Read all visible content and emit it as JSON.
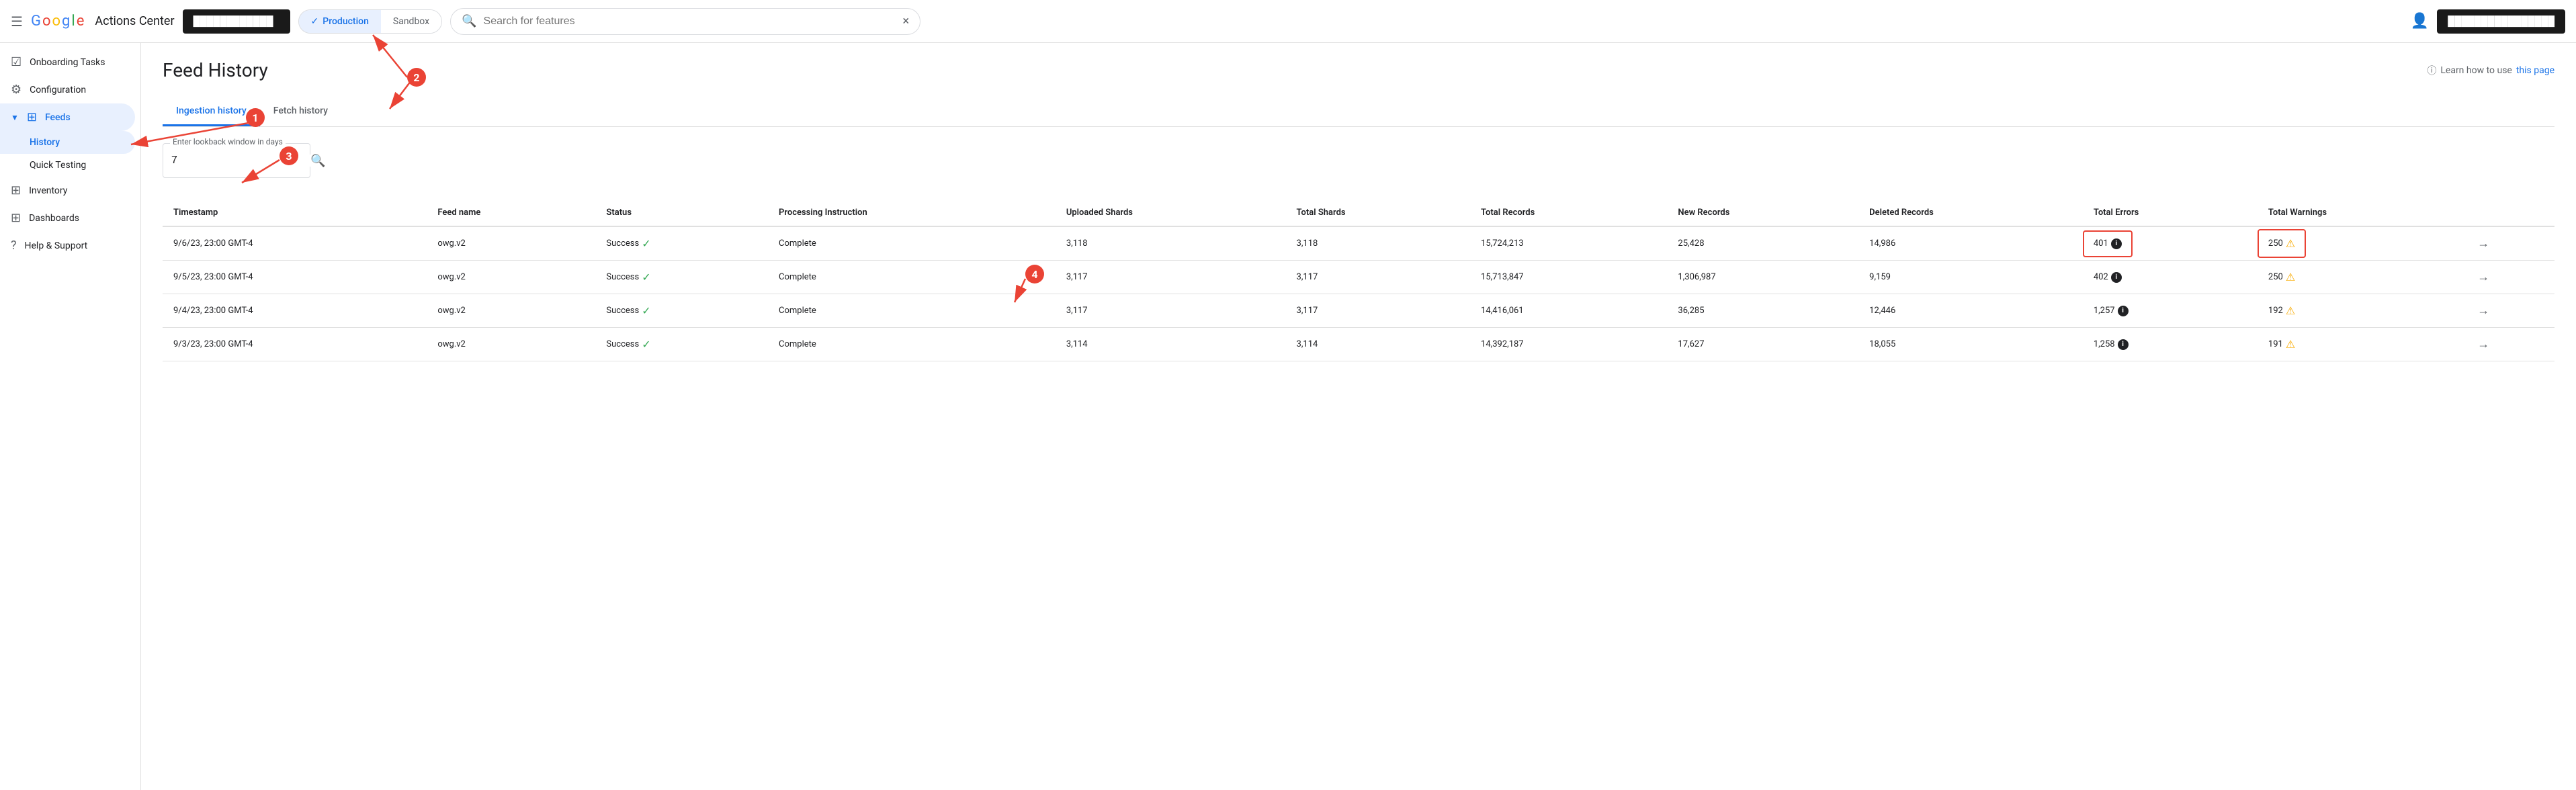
{
  "topbar": {
    "menu_icon": "☰",
    "logo_g": "G",
    "logo_o1": "o",
    "logo_o2": "o",
    "logo_g2": "g",
    "logo_l": "l",
    "logo_e": "e",
    "app_title": "Actions Center",
    "account_name": "████████████",
    "env_production": "Production",
    "env_sandbox": "Sandbox",
    "search_placeholder": "Search for features",
    "search_clear": "×",
    "account_icon": "⚙",
    "profile_block": "████████████████"
  },
  "sidebar": {
    "items": [
      {
        "id": "onboarding",
        "icon": "☑",
        "label": "Onboarding Tasks",
        "active": false
      },
      {
        "id": "configuration",
        "icon": "⚙",
        "label": "Configuration",
        "active": false
      },
      {
        "id": "feeds",
        "icon": "⊞",
        "label": "Feeds",
        "active": true,
        "expanded": true
      }
    ],
    "feeds_sub": [
      {
        "id": "history",
        "label": "History",
        "active": true
      },
      {
        "id": "quick-testing",
        "label": "Quick Testing",
        "active": false
      }
    ],
    "items2": [
      {
        "id": "inventory",
        "icon": "⊞",
        "label": "Inventory",
        "active": false
      },
      {
        "id": "dashboards",
        "icon": "⊞",
        "label": "Dashboards",
        "active": false
      },
      {
        "id": "help",
        "icon": "?",
        "label": "Help & Support",
        "active": false
      }
    ]
  },
  "page": {
    "title": "Feed History",
    "learn_text": "Learn how to use",
    "learn_link_text": "this page",
    "tabs": [
      {
        "id": "ingestion",
        "label": "Ingestion history",
        "active": true
      },
      {
        "id": "fetch",
        "label": "Fetch history",
        "active": false
      }
    ],
    "lookback_label": "Enter lookback window in days",
    "lookback_value": "7",
    "table": {
      "headers": [
        "Timestamp",
        "Feed name",
        "Status",
        "Processing Instruction",
        "Uploaded Shards",
        "Total Shards",
        "Total Records",
        "New Records",
        "Deleted Records",
        "Total Errors",
        "Total Warnings"
      ],
      "rows": [
        {
          "timestamp": "9/6/23, 23:00 GMT-4",
          "feed_name": "owg.v2",
          "status": "Success",
          "processing": "Complete",
          "uploaded_shards": "3,118",
          "total_shards": "3,118",
          "total_records": "15,724,213",
          "new_records": "25,428",
          "deleted_records": "14,986",
          "total_errors": "401",
          "total_warnings": "250",
          "highlighted": true
        },
        {
          "timestamp": "9/5/23, 23:00 GMT-4",
          "feed_name": "owg.v2",
          "status": "Success",
          "processing": "Complete",
          "uploaded_shards": "3,117",
          "total_shards": "3,117",
          "total_records": "15,713,847",
          "new_records": "1,306,987",
          "deleted_records": "9,159",
          "total_errors": "402",
          "total_warnings": "250",
          "highlighted": false
        },
        {
          "timestamp": "9/4/23, 23:00 GMT-4",
          "feed_name": "owg.v2",
          "status": "Success",
          "processing": "Complete",
          "uploaded_shards": "3,117",
          "total_shards": "3,117",
          "total_records": "14,416,061",
          "new_records": "36,285",
          "deleted_records": "12,446",
          "total_errors": "1,257",
          "total_warnings": "192",
          "highlighted": false
        },
        {
          "timestamp": "9/3/23, 23:00 GMT-4",
          "feed_name": "owg.v2",
          "status": "Success",
          "processing": "Complete",
          "uploaded_shards": "3,114",
          "total_shards": "3,114",
          "total_records": "14,392,187",
          "new_records": "17,627",
          "deleted_records": "18,055",
          "total_errors": "1,258",
          "total_warnings": "191",
          "highlighted": false
        }
      ]
    }
  },
  "annotations": {
    "label_1": "1",
    "label_2": "2",
    "label_3": "3",
    "label_4": "4"
  }
}
